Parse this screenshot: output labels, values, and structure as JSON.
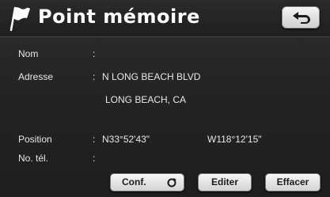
{
  "header": {
    "title": "Point mémoire",
    "flag_icon": "flag-icon",
    "back_icon": "return-arrow-icon"
  },
  "fields": {
    "name": {
      "label": "Nom",
      "colon": ":",
      "value": ""
    },
    "address": {
      "label": "Adresse",
      "colon": ":",
      "line1": "N LONG BEACH BLVD",
      "line2": "LONG BEACH, CA"
    },
    "position": {
      "label": "Position",
      "colon": ":",
      "latitude": "N33°52'43\"",
      "longitude": "W118°12'15\""
    },
    "phone": {
      "label": "No. tél.",
      "colon": ":",
      "value": ""
    }
  },
  "buttons": {
    "conf": "Conf.",
    "editer": "Editer",
    "effacer": "Effacer"
  },
  "colors": {
    "background": "#232323",
    "text": "#e8e8e8",
    "button_face": "#e6e6e6"
  }
}
